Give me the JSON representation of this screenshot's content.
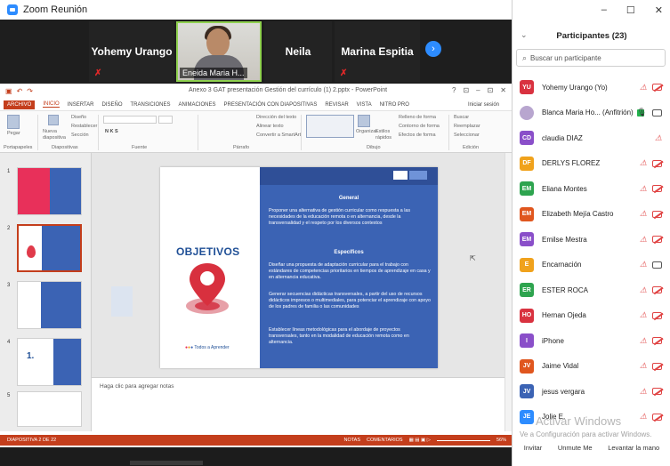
{
  "window": {
    "title": "Zoom Reunión"
  },
  "gallery": {
    "tiles": [
      {
        "name": "Yohemy Urango"
      },
      {
        "name": "Eneida Maria H..."
      },
      {
        "name": "Neila"
      },
      {
        "name": "Marina Espitia"
      }
    ]
  },
  "ppt": {
    "doc_title": "Anexo 3 GAT presentación Gestión del currículo (1) 2.pptx - PowerPoint",
    "window_controls": [
      "?",
      "⊡",
      "–",
      "⊡",
      "✕"
    ],
    "tabs": [
      "ARCHIVO",
      "INICIO",
      "INSERTAR",
      "DISEÑO",
      "TRANSICIONES",
      "ANIMACIONES",
      "PRESENTACIÓN CON DIAPOSITIVAS",
      "REVISAR",
      "VISTA",
      "NITRO PRO"
    ],
    "login": "Iniciar sesión",
    "ribbon": {
      "paste": "Pegar",
      "new_slide": "Nueva diapositiva",
      "layout": "Diseño",
      "reset": "Restablecer",
      "section": "Sección",
      "find": "Buscar",
      "replace": "Reemplazar",
      "select": "Seleccionar",
      "fill": "Relleno de forma",
      "outline": "Contorno de forma",
      "effects": "Efectos de forma",
      "text_direction": "Dirección del texto",
      "align_text": "Alinear texto",
      "smartart": "Convertir a SmartArt",
      "arrange": "Organizar",
      "quick_styles": "Estilos rápidos",
      "groups": [
        "Portapapeles",
        "Diapositivas",
        "Fuente",
        "Párrafo",
        "Dibujo",
        "Edición"
      ]
    },
    "thumbs": [
      "1",
      "2",
      "3",
      "4",
      "5"
    ],
    "slide": {
      "title": "OBJETIVOS",
      "general_heading": "General",
      "general_text": "Proponer una alternativa de gestión curricular como respuesta a las necesidades de la educación remota o en alternancia, desde la transversalidad y el respeto por los diversos contextos",
      "specific_heading": "Específicos",
      "specific_1": "Diseñar una propuesta de adaptación curricular para el trabajo con estándares de competencias prioritarios en tiempos de aprendizaje en casa y en alternancia educativa.",
      "specific_2": "Generar secuencias didácticas transversales, a partir del uso de recursos didácticos impresos o multimediales, para potenciar el aprendizaje con apoyo de los padres de familia o las comunidades",
      "specific_3": "Establecer líneas metodológicas para el abordaje de proyectos transversales, tanto en la modalidad de educación remota como en alternancia.",
      "logo_text": "Todos a Aprender"
    },
    "notes_placeholder": "Haga clic para agregar notas",
    "status": {
      "slide_info": "DIAPOSITIVA 2 DE 22",
      "notes": "NOTAS",
      "comments": "COMENTARIOS",
      "zoom": "56%"
    }
  },
  "panel": {
    "title": "Participantes (23)",
    "search_placeholder": "Buscar un participante",
    "participants": [
      {
        "initials": "YU",
        "name": "Yohemy Urango (Yo)",
        "color": "#d93240",
        "mic": "muted",
        "video": "off"
      },
      {
        "initials": "",
        "name": "Blanca Maria Ho... (Anfitrión)",
        "color": "#b8a6cf",
        "mic": "on",
        "video": "on",
        "photo": true
      },
      {
        "initials": "CD",
        "name": "claudia DIAZ",
        "color": "#8a4fc9",
        "mic": "muted",
        "video": "none"
      },
      {
        "initials": "DF",
        "name": "DERLYS FLOREZ",
        "color": "#f0a21c",
        "mic": "muted",
        "video": "off"
      },
      {
        "initials": "EM",
        "name": "Eliana Montes",
        "color": "#2ea44f",
        "mic": "muted",
        "video": "off"
      },
      {
        "initials": "EM",
        "name": "Elizabeth Mejía Castro",
        "color": "#e0561e",
        "mic": "muted",
        "video": "off"
      },
      {
        "initials": "EM",
        "name": "Emilse Mestra",
        "color": "#8a4fc9",
        "mic": "muted",
        "video": "off"
      },
      {
        "initials": "E",
        "name": "Encarnación",
        "color": "#f0a21c",
        "mic": "muted",
        "video": "on"
      },
      {
        "initials": "ER",
        "name": "ESTER ROCA",
        "color": "#2ea44f",
        "mic": "muted",
        "video": "off"
      },
      {
        "initials": "HO",
        "name": "Hernan Ojeda",
        "color": "#d93240",
        "mic": "muted",
        "video": "off"
      },
      {
        "initials": "I",
        "name": "iPhone",
        "color": "#8a4fc9",
        "mic": "muted",
        "video": "off"
      },
      {
        "initials": "JV",
        "name": "Jaime Vidal",
        "color": "#e0561e",
        "mic": "muted",
        "video": "off"
      },
      {
        "initials": "JV",
        "name": "jesus vergara",
        "color": "#3b63b4",
        "mic": "muted",
        "video": "off"
      },
      {
        "initials": "JE",
        "name": "Jolie E.",
        "color": "#2d8cff",
        "mic": "muted",
        "video": "off"
      }
    ],
    "footer": {
      "invite": "Invitar",
      "unmute": "Unmute Me",
      "raise": "Levantar la mano"
    }
  },
  "watermark": {
    "line1": "Activar Windows",
    "line2": "Ve a Configuración para activar Windows."
  }
}
